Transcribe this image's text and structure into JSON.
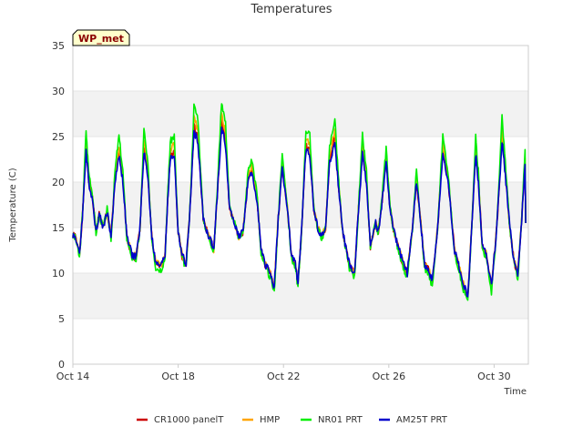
{
  "chart_data": {
    "type": "line",
    "title": "Temperatures",
    "xlabel": "Time",
    "ylabel": "Temperature (C)",
    "badge": "WP_met",
    "xlim": [
      0,
      17.3
    ],
    "ylim": [
      0,
      35
    ],
    "yticks": [
      0,
      5,
      10,
      15,
      20,
      25,
      30,
      35
    ],
    "xticks": [
      {
        "x": 0,
        "label": "Oct 14"
      },
      {
        "x": 4,
        "label": "Oct 18"
      },
      {
        "x": 8,
        "label": "Oct 22"
      },
      {
        "x": 12,
        "label": "Oct 26"
      },
      {
        "x": 16,
        "label": "Oct 30"
      }
    ],
    "grid": "horizontal bands",
    "legend_position": "bottom",
    "base_series": {
      "x": [
        0,
        0.1,
        0.25,
        0.38,
        0.5,
        0.6,
        0.75,
        0.88,
        1.0,
        1.15,
        1.3,
        1.45,
        1.6,
        1.75,
        1.9,
        2.05,
        2.25,
        2.4,
        2.55,
        2.7,
        2.85,
        3.0,
        3.15,
        3.35,
        3.5,
        3.6,
        3.7,
        3.85,
        4.0,
        4.15,
        4.3,
        4.45,
        4.6,
        4.75,
        4.95,
        5.1,
        5.25,
        5.35,
        5.45,
        5.65,
        5.8,
        5.95,
        6.15,
        6.3,
        6.45,
        6.55,
        6.65,
        6.8,
        7.0,
        7.15,
        7.3,
        7.5,
        7.65,
        7.8,
        7.95,
        8.15,
        8.3,
        8.45,
        8.55,
        8.65,
        8.85,
        9.0,
        9.15,
        9.3,
        9.45,
        9.6,
        9.75,
        9.95,
        10.1,
        10.25,
        10.35,
        10.5,
        10.7,
        10.85,
        11.0,
        11.15,
        11.3,
        11.5,
        11.6,
        11.75,
        11.9,
        12.05,
        12.2,
        12.35,
        12.55,
        12.7,
        12.9,
        13.05,
        13.25,
        13.35,
        13.5,
        13.65,
        13.85,
        14.05,
        14.25,
        14.5,
        14.65,
        14.8,
        15.0,
        15.15,
        15.3,
        15.4,
        15.55,
        15.7,
        15.9,
        16.1,
        16.3,
        16.45,
        16.6,
        16.75,
        16.9,
        17.05,
        17.2
      ],
      "y": [
        14.2,
        14.0,
        12.0,
        17.0,
        23.5,
        20.0,
        18.0,
        14.5,
        16.5,
        15.0,
        16.8,
        14.0,
        20.0,
        23.0,
        20.0,
        14.0,
        12.0,
        11.8,
        15.0,
        23.5,
        20.5,
        14.0,
        11.0,
        10.8,
        12.0,
        18.0,
        22.5,
        23.0,
        14.5,
        12.0,
        11.0,
        17.0,
        25.5,
        24.5,
        16.0,
        14.5,
        13.5,
        12.5,
        17.0,
        26.0,
        24.0,
        17.0,
        15.5,
        14.0,
        14.5,
        17.0,
        20.0,
        21.0,
        18.0,
        12.5,
        11.0,
        10.0,
        8.5,
        16.0,
        21.5,
        17.0,
        12.0,
        11.0,
        9.0,
        13.0,
        23.5,
        23.0,
        17.0,
        15.0,
        14.0,
        15.0,
        22.0,
        24.5,
        19.0,
        14.5,
        13.0,
        11.0,
        10.0,
        17.0,
        23.0,
        20.0,
        13.0,
        15.5,
        14.5,
        18.0,
        22.0,
        17.0,
        14.5,
        13.0,
        11.0,
        10.0,
        15.0,
        20.0,
        14.5,
        11.0,
        10.5,
        9.0,
        15.0,
        23.0,
        20.0,
        12.5,
        11.0,
        9.0,
        7.5,
        15.0,
        23.0,
        20.0,
        13.0,
        12.0,
        8.5,
        15.0,
        24.5,
        20.0,
        15.0,
        11.5,
        10.0,
        16.0,
        23.0,
        20.0,
        15.5
      ]
    },
    "series": [
      {
        "name": "CR1000 panelT",
        "color": "#cc0000",
        "peak_offset": 0.6,
        "trough_offset": -0.2,
        "seed": 1
      },
      {
        "name": "HMP",
        "color": "#ffa500",
        "peak_offset": 1.6,
        "trough_offset": 0.1,
        "seed": 2
      },
      {
        "name": "NR01 PRT",
        "color": "#00ee00",
        "peak_offset": 3.0,
        "trough_offset": -0.8,
        "seed": 3
      },
      {
        "name": "AM25T PRT",
        "color": "#0000cc",
        "peak_offset": 0.0,
        "trough_offset": 0.0,
        "seed": 4
      }
    ]
  }
}
